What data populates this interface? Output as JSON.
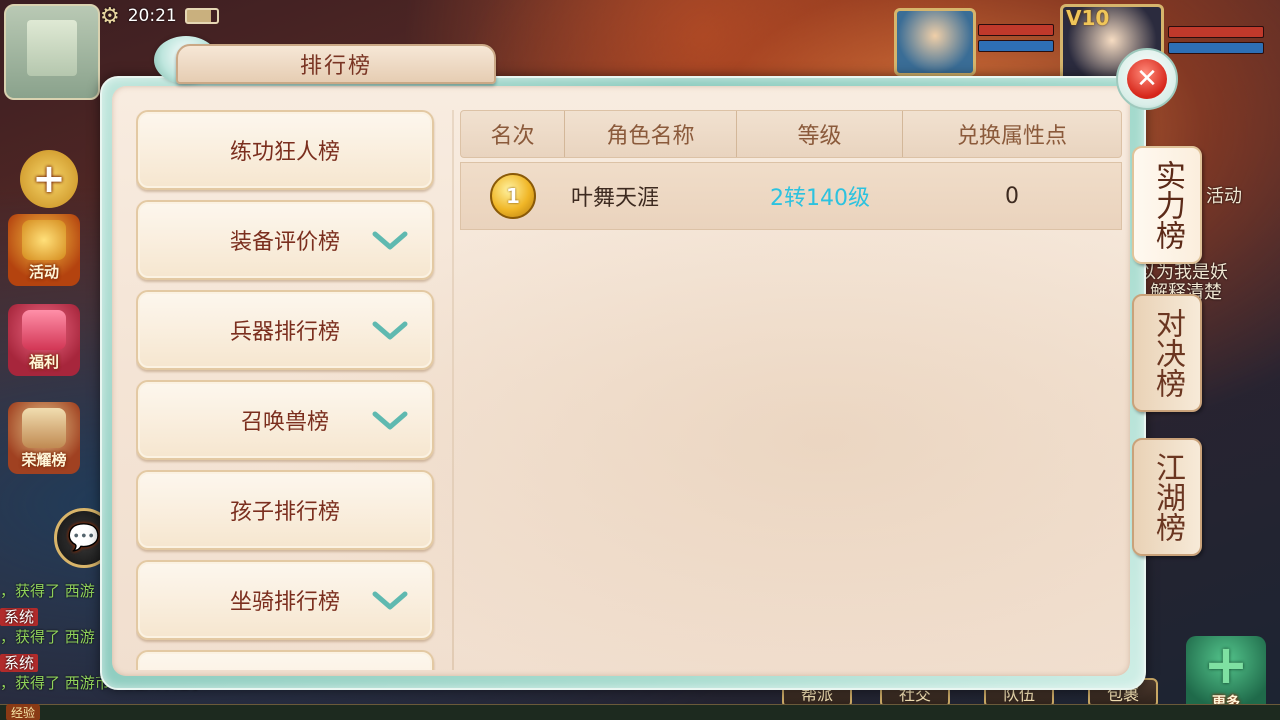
{
  "hud": {
    "clock": "20:21",
    "activity_label": "活动",
    "welfare_label": "福利",
    "honor_label": "荣耀榜",
    "more_label": "更多",
    "vip_label": "V10",
    "exp_label": "经验",
    "side_text_1": "活动",
    "side_text_2": "以为我是妖",
    "side_text_3": "解释清楚",
    "bottom_buttons": [
      "帮派",
      "社交",
      "队伍",
      "包裹"
    ],
    "chat": [
      {
        "tag": "",
        "text": "，获得了 西游"
      },
      {
        "tag": "系统",
        "text": ""
      },
      {
        "tag": "",
        "text": "，获得了 西游"
      },
      {
        "tag": "系统",
        "text": ""
      },
      {
        "tag": "",
        "text": "，获得了 西游币 真是太幸运了!"
      }
    ]
  },
  "modal": {
    "title": "排行榜",
    "close_symbol": "✕",
    "left_list": [
      {
        "label": "练功狂人榜",
        "expandable": false
      },
      {
        "label": "装备评价榜",
        "expandable": true
      },
      {
        "label": "兵器排行榜",
        "expandable": true
      },
      {
        "label": "召唤兽榜",
        "expandable": true
      },
      {
        "label": "孩子排行榜",
        "expandable": false
      },
      {
        "label": "坐骑排行榜",
        "expandable": true
      },
      {
        "label": "",
        "expandable": false
      }
    ],
    "table": {
      "headers": [
        "名次",
        "角色名称",
        "等级",
        "兑换属性点"
      ],
      "rows": [
        {
          "rank": "1",
          "name": "叶舞天涯",
          "level": "2转140级",
          "points": "0"
        }
      ]
    },
    "side_tabs": [
      {
        "label": "实力榜",
        "active": true
      },
      {
        "label": "对决榜",
        "active": false
      },
      {
        "label": "江湖榜",
        "active": false
      }
    ]
  },
  "colors": {
    "level_text": "#2cc2df",
    "chevron": "#5fb9b0",
    "title_text": "#7a3524"
  }
}
